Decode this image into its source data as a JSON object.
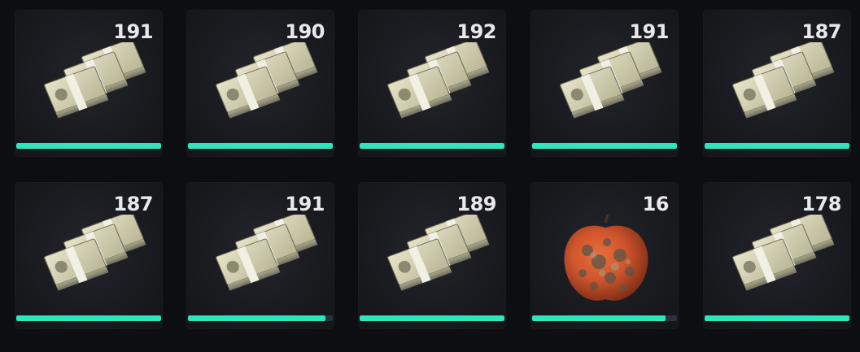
{
  "inventory": {
    "slots": [
      {
        "item": "money-stack",
        "count": "191",
        "durability": 1.0
      },
      {
        "item": "money-stack",
        "count": "190",
        "durability": 1.0
      },
      {
        "item": "money-stack",
        "count": "192",
        "durability": 1.0
      },
      {
        "item": "money-stack",
        "count": "191",
        "durability": 1.0
      },
      {
        "item": "money-stack",
        "count": "187",
        "durability": 1.0
      },
      {
        "item": "money-stack",
        "count": "187",
        "durability": 1.0
      },
      {
        "item": "money-stack",
        "count": "191",
        "durability": 0.95
      },
      {
        "item": "money-stack",
        "count": "189",
        "durability": 1.0
      },
      {
        "item": "rotten-apple",
        "count": "16",
        "durability": 0.92
      },
      {
        "item": "money-stack",
        "count": "178",
        "durability": 1.0
      }
    ],
    "colors": {
      "bar_fill": "#2ee6bd",
      "bar_track": "#2a3140",
      "background": "#0d0e12"
    }
  }
}
